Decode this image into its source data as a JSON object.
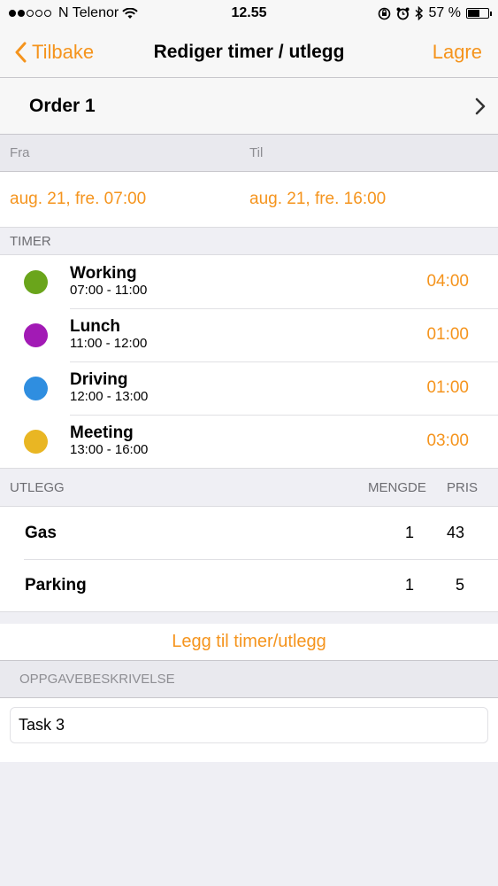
{
  "status": {
    "carrier": "N Telenor",
    "time": "12.55",
    "battery_text": "57 %",
    "battery_level": 0.57,
    "signal_dots_filled": 2,
    "signal_dots_total": 5
  },
  "nav": {
    "back_label": "Tilbake",
    "title": "Rediger timer / utlegg",
    "save_label": "Lagre"
  },
  "order": {
    "label": "Order 1"
  },
  "period": {
    "from_label": "Fra",
    "to_label": "Til",
    "from_value": "aug. 21, fre. 07:00",
    "to_value": "aug. 21, fre. 16:00"
  },
  "timer": {
    "header": "TIMER",
    "items": [
      {
        "name": "Working",
        "range": "07:00 - 11:00",
        "duration": "04:00",
        "color": "#6aa51b"
      },
      {
        "name": "Lunch",
        "range": "11:00 - 12:00",
        "duration": "01:00",
        "color": "#a21ab5"
      },
      {
        "name": "Driving",
        "range": "12:00 - 13:00",
        "duration": "01:00",
        "color": "#2f8ee0"
      },
      {
        "name": "Meeting",
        "range": "13:00 - 16:00",
        "duration": "03:00",
        "color": "#e9b623"
      }
    ]
  },
  "utlegg": {
    "header": "UTLEGG",
    "col_quantity": "MENGDE",
    "col_price": "PRIS",
    "items": [
      {
        "name": "Gas",
        "quantity": "1",
        "price": "43"
      },
      {
        "name": "Parking",
        "quantity": "1",
        "price": "5"
      }
    ]
  },
  "add_label": "Legg til timer/utlegg",
  "description": {
    "header": "OPPGAVEBESKRIVELSE",
    "value": "Task 3"
  },
  "colors": {
    "accent": "#f5941d"
  }
}
